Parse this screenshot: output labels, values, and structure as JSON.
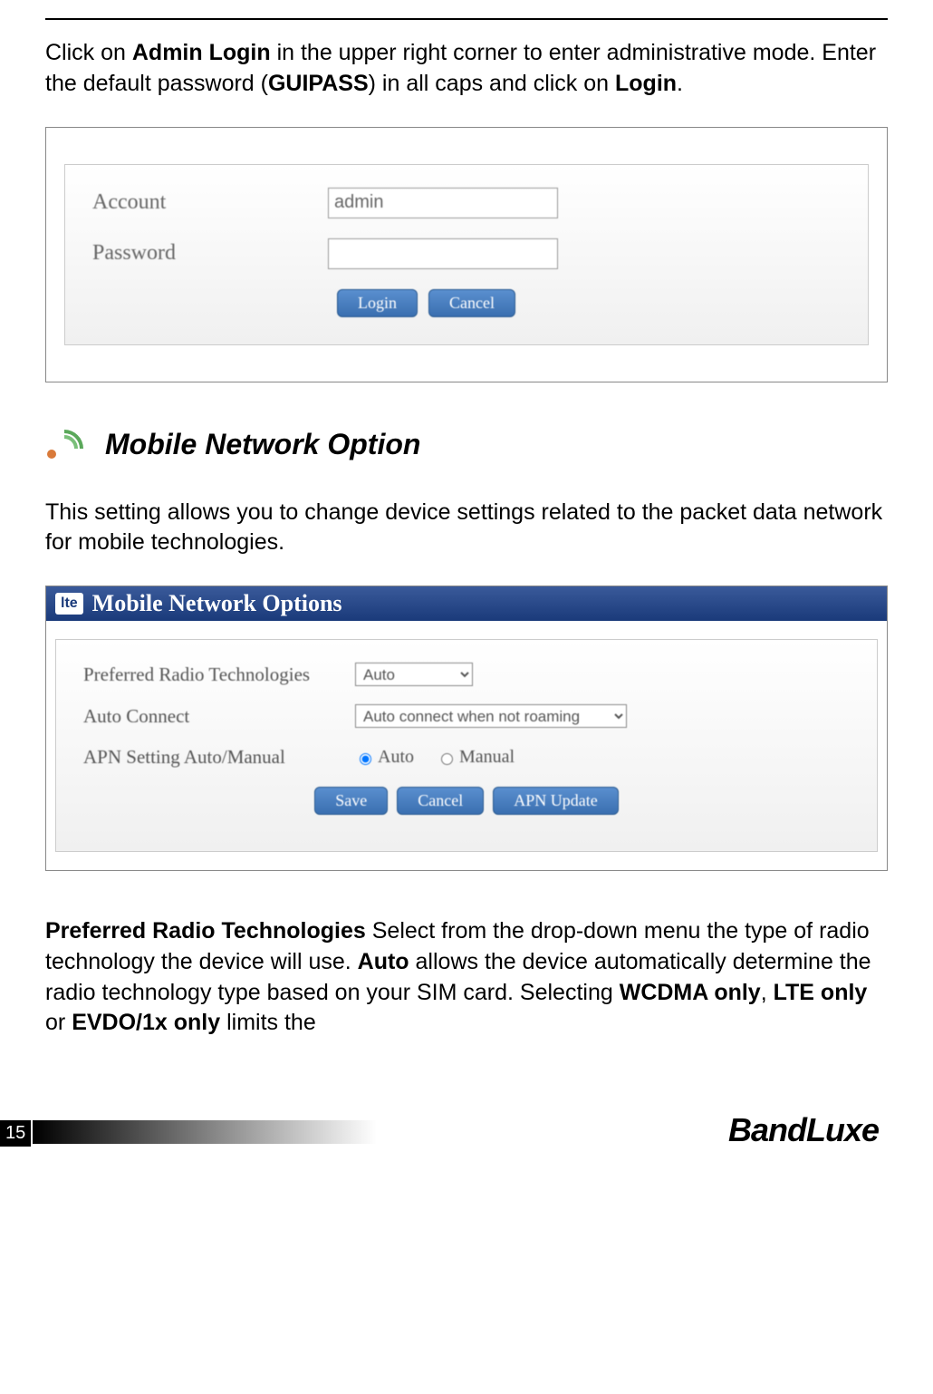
{
  "intro": {
    "part1": "Click on ",
    "bold1": "Admin Login",
    "part2": " in the upper right corner to enter administrative mode. Enter the default password (",
    "bold2": "GUIPASS",
    "part3": ") in all caps and click on ",
    "bold3": "Login",
    "part4": "."
  },
  "login": {
    "account_label": "Account",
    "password_label": "Password",
    "account_value": "admin",
    "password_value": "",
    "login_btn": "Login",
    "cancel_btn": "Cancel"
  },
  "section": {
    "title": "Mobile Network Option",
    "desc": "This setting allows you to change device settings related to the packet data network for mobile technologies."
  },
  "mno": {
    "header_badge": "lte",
    "header_title": "Mobile Network Options",
    "prt_label": "Preferred Radio Technologies",
    "prt_value": "Auto",
    "auto_connect_label": "Auto Connect",
    "auto_connect_value": "Auto connect when not roaming",
    "apn_label": "APN Setting Auto/Manual",
    "apn_auto": "Auto",
    "apn_manual": "Manual",
    "save_btn": "Save",
    "cancel_btn": "Cancel",
    "apn_update_btn": "APN Update"
  },
  "outro": {
    "bold1": "Preferred Radio Technologies",
    "part1": " Select from the drop-down menu the type of radio technology the device will use. ",
    "bold2": "Auto",
    "part2": " allows the device automatically determine the radio technology type based on your SIM card. Selecting ",
    "bold3": "WCDMA only",
    "part3": ", ",
    "bold4": "LTE only",
    "part4": " or ",
    "bold5": "EVDO/1x only",
    "part5": " limits the"
  },
  "footer": {
    "page_number": "15",
    "brand": "BandLuxe"
  }
}
